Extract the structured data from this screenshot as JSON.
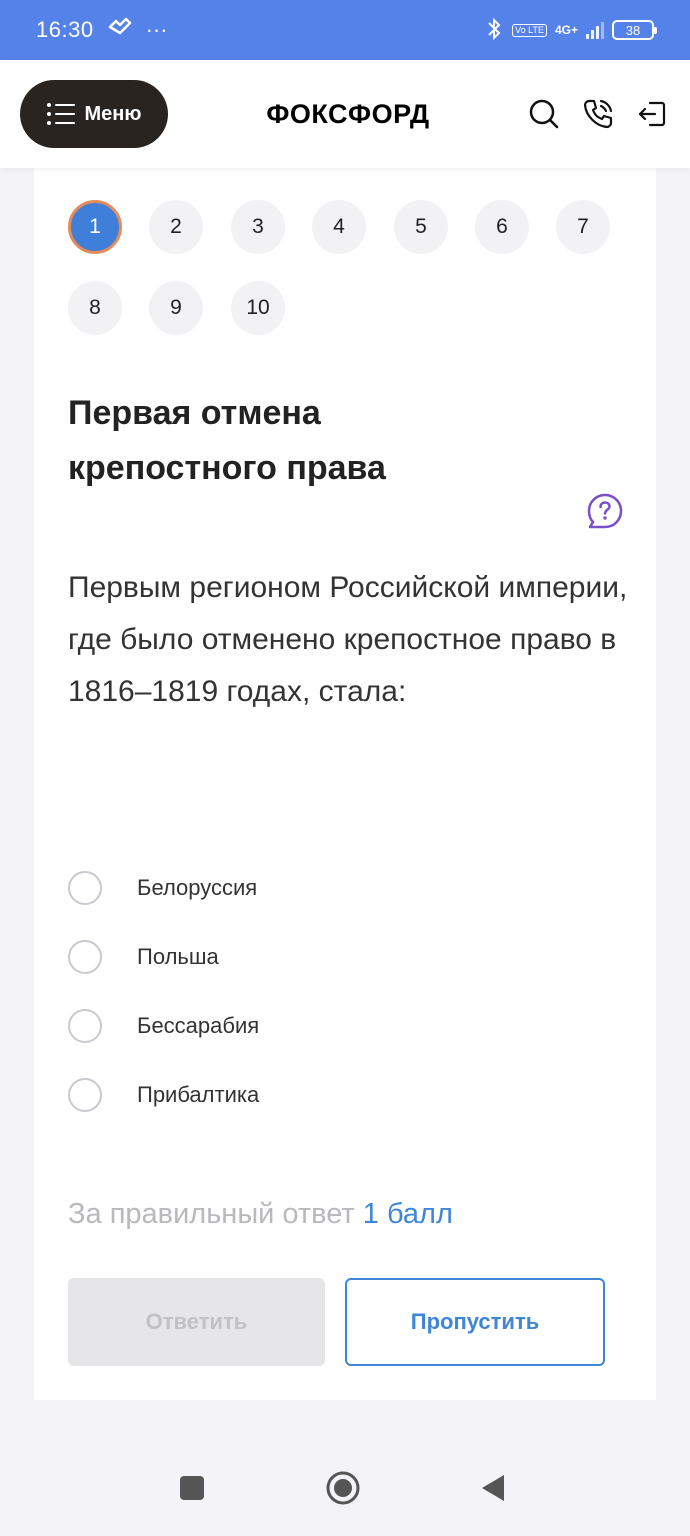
{
  "status_bar": {
    "time": "16:30",
    "more": "···",
    "volte": "Vo LTE",
    "network": "4G+",
    "battery": "38"
  },
  "header": {
    "menu_label": "Меню",
    "logo": "ФОКСФОРД"
  },
  "pager": {
    "pages": [
      "1",
      "2",
      "3",
      "4",
      "5",
      "6",
      "7",
      "8",
      "9",
      "10"
    ],
    "active": "1"
  },
  "question": {
    "title": "Первая отмена крепостного права",
    "text": "Первым регионом Российской империи, где было отменено крепостное право в 1816–1819 годах, стала:",
    "options": [
      "Белоруссия",
      "Польша",
      "Бессарабия",
      "Прибалтика"
    ]
  },
  "scoring": {
    "prefix": "За правильный ответ",
    "value": "1 балл"
  },
  "actions": {
    "answer_label": "Ответить",
    "skip_label": "Пропустить"
  },
  "colors": {
    "status_bar": "#5582e8",
    "accent": "#3f86d6",
    "active_page": "#3f7fd9",
    "active_ring": "#e58b5a",
    "help_icon": "#7b4fc9",
    "menu_button": "#2a2421"
  }
}
